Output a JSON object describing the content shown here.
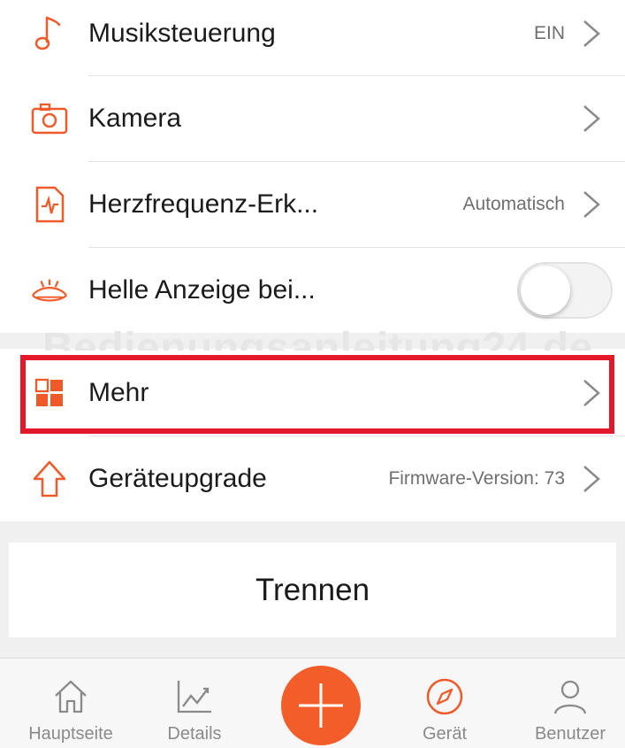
{
  "colors": {
    "accent": "#f05a28",
    "highlight": "#e3192b",
    "text": "#1b1b1b",
    "secondary": "#6f6f6f"
  },
  "watermark": "Bedienungsanleitung24.de",
  "settings": {
    "rows": [
      {
        "label": "Musiksteuerung",
        "value": "EIN",
        "icon": "music-note-icon"
      },
      {
        "label": "Kamera",
        "value": "",
        "icon": "camera-icon"
      },
      {
        "label": "Herzfrequenz-Erk...",
        "value": "Automatisch",
        "icon": "heart-rate-icon"
      },
      {
        "label": "Helle Anzeige bei...",
        "toggle_on": false,
        "icon": "raise-wrist-icon"
      },
      {
        "label": "Mehr",
        "value": "",
        "icon": "more-grid-icon"
      },
      {
        "label": "Geräteupgrade",
        "value": "Firmware-Version: 73",
        "icon": "upgrade-arrow-icon"
      }
    ]
  },
  "disconnect": {
    "label": "Trennen"
  },
  "tabbar": {
    "tabs": [
      {
        "label": "Hauptseite",
        "icon": "home-icon",
        "active": false
      },
      {
        "label": "Details",
        "icon": "chart-icon",
        "active": false
      },
      {
        "label": "",
        "icon": "plus-icon",
        "active": false
      },
      {
        "label": "Gerät",
        "icon": "compass-icon",
        "active": true
      },
      {
        "label": "Benutzer",
        "icon": "user-icon",
        "active": false
      }
    ]
  }
}
